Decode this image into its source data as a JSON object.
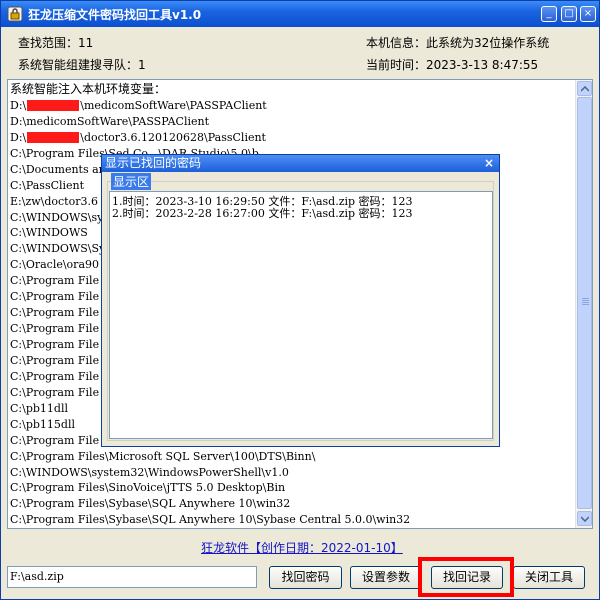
{
  "window": {
    "title": "狂龙压缩文件密码找回工具v1.0",
    "controls": {
      "minimize": "_",
      "maximize": "□",
      "close": "×"
    }
  },
  "info": {
    "search_range_label": "查找范围：11",
    "smart_queue_label": "系统智能组建搜寻队：1",
    "machine_info": "本机信息：此系统为32位操作系统",
    "current_time": "当前时间：2023-3-13 8:47:55"
  },
  "log": {
    "header": "系统智能注入本机环境变量：",
    "lines": [
      {
        "pre": "D:\\",
        "redacted": true,
        "post": "\\medicomSoftWare\\PASSPAClient"
      },
      {
        "pre": "D:\\medicomSoftWare\\PASSPAClient",
        "redacted": false,
        "post": ""
      },
      {
        "pre": "D:\\",
        "redacted": true,
        "post": "\\doctor3.6.120120628\\PassClient"
      },
      {
        "pre": "C:\\Program Files\\Sed Co...\\DAR Studio\\5.0\\b...",
        "redacted": false,
        "post": ""
      },
      {
        "pre": "C:\\Documents an",
        "redacted": false,
        "post": ""
      },
      {
        "pre": "C:\\PassClient",
        "redacted": false,
        "post": ""
      },
      {
        "pre": "E:\\zw\\doctor3.6",
        "redacted": false,
        "post": ""
      },
      {
        "pre": "C:\\WINDOWS\\syst",
        "redacted": false,
        "post": ""
      },
      {
        "pre": "C:\\WINDOWS",
        "redacted": false,
        "post": ""
      },
      {
        "pre": "C:\\WINDOWS\\Syst",
        "redacted": false,
        "post": ""
      },
      {
        "pre": "C:\\Oracle\\ora90",
        "redacted": false,
        "post": ""
      },
      {
        "pre": "C:\\Program File",
        "redacted": false,
        "post": ""
      },
      {
        "pre": "C:\\Program File",
        "redacted": false,
        "post": ""
      },
      {
        "pre": "C:\\Program File",
        "redacted": false,
        "post": ""
      },
      {
        "pre": "C:\\Program File",
        "redacted": false,
        "post": ""
      },
      {
        "pre": "C:\\Program File",
        "redacted": false,
        "post": ""
      },
      {
        "pre": "C:\\Program File",
        "redacted": false,
        "post": ""
      },
      {
        "pre": "C:\\Program File",
        "redacted": false,
        "post": ""
      },
      {
        "pre": "C:\\Program File",
        "redacted": false,
        "post": ""
      },
      {
        "pre": "C:\\pb11dll",
        "redacted": false,
        "post": ""
      },
      {
        "pre": "C:\\pb115dll",
        "redacted": false,
        "post": ""
      },
      {
        "pre": "C:\\Program File",
        "redacted": false,
        "post": ""
      },
      {
        "pre": "C:\\Program Files\\Microsoft SQL Server\\100\\DTS\\Binn\\",
        "redacted": false,
        "post": ""
      },
      {
        "pre": "C:\\WINDOWS\\system32\\WindowsPowerShell\\v1.0",
        "redacted": false,
        "post": ""
      },
      {
        "pre": "C:\\Program Files\\SinoVoice\\jTTS 5.0 Desktop\\Bin",
        "redacted": false,
        "post": ""
      },
      {
        "pre": "C:\\Program Files\\Sybase\\SQL Anywhere 10\\win32",
        "redacted": false,
        "post": ""
      },
      {
        "pre": "C:\\Program Files\\Sybase\\SQL Anywhere 10\\Sybase Central 5.0.0\\win32",
        "redacted": false,
        "post": ""
      }
    ]
  },
  "dialog": {
    "title": "显示已找回的密码",
    "close": "×",
    "group_label": "显示区",
    "entries": [
      "1.时间：2023-3-10 16:29:50 文件：F:\\asd.zip 密码：123",
      "2.时间：2023-2-28 16:27:00 文件：F:\\asd.zip 密码：123"
    ]
  },
  "footer": {
    "link": "狂龙软件【创作日期：2022-01-10】",
    "path_value": "F:\\asd.zip",
    "buttons": {
      "recover_password": "找回密码",
      "settings": "设置参数",
      "recover_records": "找回记录",
      "close_tool": "关闭工具"
    }
  },
  "colors": {
    "titlebar": "#0b4fd0",
    "highlight": "#ff0000",
    "redaction": "#ff1a1a",
    "link": "#1414c8"
  },
  "icons": {
    "app": "key-lock-icon",
    "scroll_up": "arrow-up-icon",
    "scroll_down": "arrow-down-icon"
  }
}
